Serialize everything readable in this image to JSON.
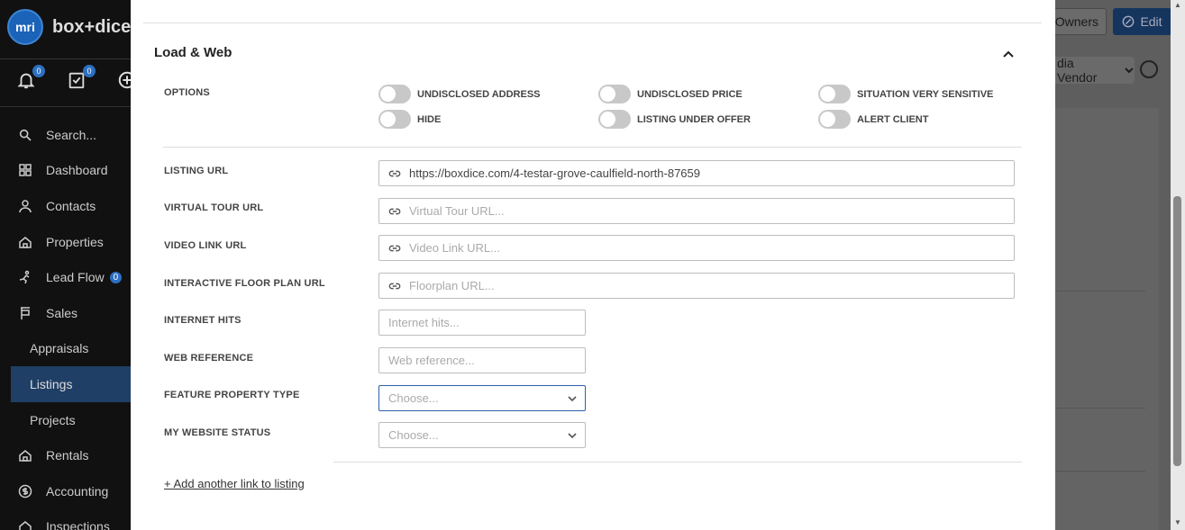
{
  "app": {
    "logo_text": "mri",
    "brand": "box+dice"
  },
  "top_icons": {
    "notifications_count": "0",
    "tasks_count": "0"
  },
  "sidebar": {
    "search_label": "Search...",
    "items": [
      {
        "label": "Dashboard",
        "icon": "grid-icon"
      },
      {
        "label": "Contacts",
        "icon": "person-icon"
      },
      {
        "label": "Properties",
        "icon": "home-icon"
      },
      {
        "label": "Lead Flow",
        "icon": "lead-flow-icon",
        "badge": "0"
      },
      {
        "label": "Sales",
        "icon": "sales-icon"
      },
      {
        "label": "Appraisals"
      },
      {
        "label": "Listings",
        "active": true
      },
      {
        "label": "Projects"
      },
      {
        "label": "Rentals",
        "icon": "home-icon"
      },
      {
        "label": "Accounting",
        "icon": "dollar-icon"
      },
      {
        "label": "Inspections",
        "icon": "home-icon"
      }
    ]
  },
  "background": {
    "owners_label": "Owners",
    "edit_label": "Edit",
    "vendor_label": "dia Vendor"
  },
  "modal": {
    "section_title": "Load & Web",
    "options_label": "OPTIONS",
    "toggles": [
      {
        "label": "UNDISCLOSED ADDRESS",
        "on": false
      },
      {
        "label": "UNDISCLOSED PRICE",
        "on": false
      },
      {
        "label": "SITUATION VERY SENSITIVE",
        "on": false
      },
      {
        "label": "HIDE",
        "on": false
      },
      {
        "label": "LISTING UNDER OFFER",
        "on": false
      },
      {
        "label": "ALERT CLIENT",
        "on": false
      }
    ],
    "listing_url": {
      "label": "LISTING URL",
      "value": "https://boxdice.com/4-testar-grove-caulfield-north-87659"
    },
    "virtual_tour_url": {
      "label": "VIRTUAL TOUR URL",
      "placeholder": "Virtual Tour URL..."
    },
    "video_link_url": {
      "label": "VIDEO LINK URL",
      "placeholder": "Video Link URL..."
    },
    "floor_plan_url": {
      "label": "INTERACTIVE FLOOR PLAN URL",
      "placeholder": "Floorplan URL..."
    },
    "internet_hits": {
      "label": "INTERNET HITS",
      "placeholder": "Internet hits..."
    },
    "web_reference": {
      "label": "WEB REFERENCE",
      "placeholder": "Web reference..."
    },
    "feature_property_type": {
      "label": "FEATURE PROPERTY TYPE",
      "placeholder": "Choose..."
    },
    "my_website_status": {
      "label": "MY WEBSITE STATUS",
      "placeholder": "Choose..."
    },
    "add_link_label": "+ Add another link to listing"
  }
}
